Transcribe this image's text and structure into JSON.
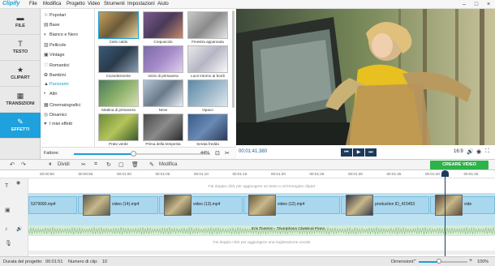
{
  "app": {
    "logo": "Clipify"
  },
  "menu": [
    "File",
    "Modifica",
    "Progetto",
    "Video",
    "Strumenti",
    "Impostazioni",
    "Aiuto"
  ],
  "window_controls": [
    "–",
    "□",
    "×"
  ],
  "sidebar": [
    {
      "label": "FILE",
      "icon": "folder-icon",
      "glyph": "▬"
    },
    {
      "label": "TESTO",
      "icon": "text-icon",
      "glyph": "T"
    },
    {
      "label": "CLIPART",
      "icon": "star-icon",
      "glyph": "★"
    },
    {
      "label": "TRANSIZIONI",
      "icon": "transition-icon",
      "glyph": "▦"
    },
    {
      "label": "EFFETTI",
      "icon": "effects-icon",
      "glyph": "✎"
    }
  ],
  "categories": [
    {
      "label": "Popolari",
      "glyph": "☆"
    },
    {
      "label": "Base",
      "glyph": "▤"
    },
    {
      "label": "Bianco e Nero",
      "glyph": "◐"
    },
    {
      "label": "Pellicole",
      "glyph": "▥"
    },
    {
      "label": "Vintage",
      "glyph": "▣"
    },
    {
      "label": "Romantici",
      "glyph": "♡"
    },
    {
      "label": "Bambini",
      "glyph": "✿"
    },
    {
      "label": "Panorami",
      "glyph": "▲"
    },
    {
      "label": "Altri",
      "glyph": "•"
    },
    {
      "label": "Cinematografici",
      "glyph": "▦"
    },
    {
      "label": "Dinamici",
      "glyph": "◎"
    },
    {
      "label": "I miei effetti",
      "glyph": "♥"
    }
  ],
  "selected_category": "Panorami",
  "filters": [
    {
      "label": "Cielo caldo",
      "bg": "linear-gradient(135deg,#c9a15a,#6b5a3a,#e8d6a0)"
    },
    {
      "label": "Crepuscolo",
      "bg": "linear-gradient(135deg,#7a5a8a,#4a3a5a,#c88a6a)"
    },
    {
      "label": "Finestra appannata",
      "bg": "linear-gradient(135deg,#c9c9c9,#8a8a8a,#e6e6e6)"
    },
    {
      "label": "Incandescente",
      "bg": "linear-gradient(135deg,#3a5a7a,#2a3a4a,#8aa0b5)"
    },
    {
      "label": "Inizio di primavera",
      "bg": "linear-gradient(135deg,#7a6aa5,#a58ac8,#e0d0f0)"
    },
    {
      "label": "Luce intorno ai bordi",
      "bg": "linear-gradient(135deg,#e8e8e8,#b5b5c5,#fafafa)"
    },
    {
      "label": "Mattina di primavera",
      "bg": "linear-gradient(135deg,#4a7a5a,#8ab06a,#d8e0b0)"
    },
    {
      "label": "Neve",
      "bg": "linear-gradient(135deg,#b5c5d8,#6a7a8a,#e8eef5)"
    },
    {
      "label": "Opaco",
      "bg": "linear-gradient(135deg,#5a8aa5,#9ab5c8,#dfe8ee)"
    },
    {
      "label": "Prato verde",
      "bg": "linear-gradient(135deg,#6a8a3a,#b5c55a,#3a5a2a)"
    },
    {
      "label": "Prima della tempesta",
      "bg": "linear-gradient(135deg,#4a4a4a,#8a8a8a,#2a2a2a)"
    },
    {
      "label": "Serata fredda",
      "bg": "linear-gradient(135deg,#3a5a8a,#6a8ab5,#2a3a5a)"
    },
    {
      "label": "",
      "bg": "linear-gradient(135deg,#a57a4a,#5a3a2a,#c8a07a)"
    },
    {
      "label": "",
      "bg": "linear-gradient(135deg,#d8a04a,#8a5a2a,#f0d08a)"
    },
    {
      "label": "",
      "bg": "linear-gradient(135deg,#5a6a8a,#3a4a5a,#8a9ab5)"
    }
  ],
  "strength": {
    "label": "Fattore:",
    "value_text": "44%",
    "value": 0.44
  },
  "preview": {
    "timecode": "00:01:41.380",
    "ratio": "16:9"
  },
  "toolbar": {
    "split_label": "Dividi",
    "edit_label": "Modifica",
    "create_label": "CREARE VIDEO"
  },
  "ruler_ticks": [
    "00:00:50",
    "00:00:55",
    "00:01:00",
    "00:01:05",
    "00:01:10",
    "00:01:15",
    "00:01:20",
    "00:01:25",
    "00:01:30",
    "00:01:35",
    "00:01:40",
    "00:01:45"
  ],
  "timeline": {
    "text_hint": "Fai doppio click per aggiungere un testo o un'immagine clipart",
    "voice_hint": "Fai doppio click per aggiungere una registrazione vocale",
    "clips": [
      "5379990.mp4",
      "video (14).mp4",
      "video (13).mp4",
      "video (12).mp4",
      "production ID_415453",
      "vide"
    ],
    "audio": "Eric Tiverton - Triumphans Classical Piano"
  },
  "status": {
    "duration_label": "Durata del progetto:",
    "duration_value": "00:01:51",
    "clips_label": "Numero di clip:",
    "clips_value": "10",
    "dimension_label": "Dimensioni:",
    "zoom_text": "100%"
  },
  "colors": {
    "accent": "#1ea1dc",
    "create": "#2db34a",
    "player": "#1d3a5c"
  }
}
